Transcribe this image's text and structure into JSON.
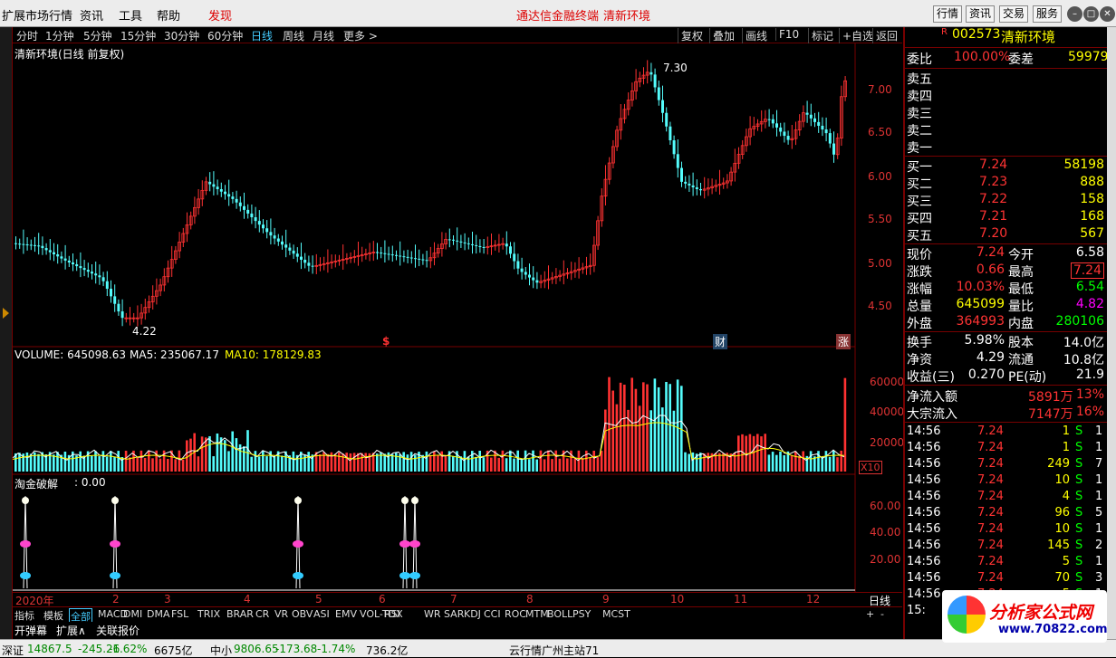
{
  "menu": {
    "items": [
      "扩展市场行情",
      "资讯",
      "工具",
      "帮助",
      "发现"
    ],
    "center": [
      "通达信金融终端",
      "清新环境"
    ],
    "right_buttons": [
      "行情",
      "资讯",
      "交易",
      "服务"
    ]
  },
  "periods": {
    "items": [
      "分时",
      "1分钟",
      "5分钟",
      "15分钟",
      "30分钟",
      "60分钟",
      "日线",
      "周线",
      "月线",
      "更多 >"
    ],
    "active": "日线",
    "tools": [
      "复权",
      "叠加",
      "画线",
      "F10",
      "标记",
      "+自选",
      "返回"
    ]
  },
  "main_chart": {
    "title": "清新环境(日线 前复权)",
    "high_label": "7.30",
    "low_label": "4.22",
    "price_ticks": [
      "7.00",
      "6.50",
      "6.00",
      "5.50",
      "5.00",
      "4.50"
    ],
    "markers": [
      "$",
      "财",
      "涨"
    ]
  },
  "volume_panel": {
    "label": "VOLUME: 645098.63",
    "ma5": "MA5: 235067.17",
    "ma10": "MA10: 178129.83",
    "ticks": [
      "60000",
      "40000",
      "20000"
    ],
    "unit": "X10"
  },
  "indicator_panel": {
    "label": "淘金破解",
    "value": ": 0.00",
    "ticks": [
      "60.00",
      "40.00",
      "20.00"
    ]
  },
  "date_axis": {
    "labels": [
      "2020年",
      "2",
      "3",
      "4",
      "5",
      "6",
      "7",
      "8",
      "9",
      "10",
      "11",
      "12"
    ],
    "period_label": "日线"
  },
  "indicator_tabs": {
    "items": [
      "指标",
      "模板",
      "全部",
      "MACD",
      "DMI",
      "DMA",
      "FSL",
      "TRIX",
      "BRAR",
      "CR",
      "VR",
      "OBV",
      "ASI",
      "EMV",
      "VOL-TDX",
      "RSI",
      "WR",
      "SAR",
      "KDJ",
      "CCI",
      "ROC",
      "MTM",
      "BOLL",
      "PSY",
      "MCST"
    ],
    "active": "全部"
  },
  "bottom_tabs": [
    "开弹幕",
    "扩展∧",
    "关联报价"
  ],
  "quote": {
    "code": "002573",
    "name": "清新环境",
    "flag": "R",
    "weibi": {
      "label": "委比",
      "value": "100.00%",
      "label2": "委差",
      "value2": "59979"
    },
    "sell": [
      {
        "label": "卖五"
      },
      {
        "label": "卖四"
      },
      {
        "label": "卖三"
      },
      {
        "label": "卖二"
      },
      {
        "label": "卖一"
      }
    ],
    "buy": [
      {
        "label": "买一",
        "price": "7.24",
        "vol": "58198"
      },
      {
        "label": "买二",
        "price": "7.23",
        "vol": "888"
      },
      {
        "label": "买三",
        "price": "7.22",
        "vol": "158"
      },
      {
        "label": "买四",
        "price": "7.21",
        "vol": "168"
      },
      {
        "label": "买五",
        "price": "7.20",
        "vol": "567"
      }
    ],
    "stats": [
      {
        "l1": "现价",
        "v1": "7.24",
        "l2": "今开",
        "v2": "6.58"
      },
      {
        "l1": "涨跌",
        "v1": "0.66",
        "l2": "最高",
        "v2": "7.24"
      },
      {
        "l1": "涨幅",
        "v1": "10.03%",
        "l2": "最低",
        "v2": "6.54"
      },
      {
        "l1": "总量",
        "v1": "645099",
        "l2": "量比",
        "v2": "4.82"
      },
      {
        "l1": "外盘",
        "v1": "364993",
        "l2": "内盘",
        "v2": "280106"
      },
      {
        "l1": "换手",
        "v1": "5.98%",
        "l2": "股本",
        "v2": "14.0亿"
      },
      {
        "l1": "净资",
        "v1": "4.29",
        "l2": "流通",
        "v2": "10.8亿"
      },
      {
        "l1": "收益(三)",
        "v1": "0.270",
        "l2": "PE(动)",
        "v2": "21.9"
      }
    ],
    "flow": [
      {
        "label": "净流入额",
        "value": "5891万",
        "pct": "13%"
      },
      {
        "label": "大宗流入",
        "value": "7147万",
        "pct": "16%"
      }
    ],
    "ticks": [
      {
        "t": "14:56",
        "p": "7.24",
        "v": "1",
        "s": "S",
        "n": "1"
      },
      {
        "t": "14:56",
        "p": "7.24",
        "v": "1",
        "s": "S",
        "n": "1"
      },
      {
        "t": "14:56",
        "p": "7.24",
        "v": "249",
        "s": "S",
        "n": "7"
      },
      {
        "t": "14:56",
        "p": "7.24",
        "v": "10",
        "s": "S",
        "n": "1"
      },
      {
        "t": "14:56",
        "p": "7.24",
        "v": "4",
        "s": "S",
        "n": "1"
      },
      {
        "t": "14:56",
        "p": "7.24",
        "v": "96",
        "s": "S",
        "n": "5"
      },
      {
        "t": "14:56",
        "p": "7.24",
        "v": "10",
        "s": "S",
        "n": "1"
      },
      {
        "t": "14:56",
        "p": "7.24",
        "v": "145",
        "s": "S",
        "n": "2"
      },
      {
        "t": "14:56",
        "p": "7.24",
        "v": "5",
        "s": "S",
        "n": "1"
      },
      {
        "t": "14:56",
        "p": "7.24",
        "v": "70",
        "s": "S",
        "n": "3"
      },
      {
        "t": "14:56",
        "p": "7.24",
        "v": "5",
        "s": "S",
        "n": "1"
      },
      {
        "t": "15:",
        "p": "",
        "v": "",
        "s": "",
        "n": ""
      }
    ]
  },
  "status": {
    "items": [
      "深证",
      "14867.5",
      "-245.26",
      "-1.62%",
      "6675亿",
      "中小",
      "9806.65",
      "-173.68",
      "-1.74%",
      "736.2亿",
      "云行情广州主站71"
    ]
  },
  "logo": {
    "title": "分析家公式网",
    "url": "www.70822.com"
  },
  "colors": {
    "up": "#ff3232",
    "down": "#54fcfc",
    "yellow": "#ffff00",
    "green": "#00ff00",
    "ma5": "#ffffff",
    "ma10": "#ffff00"
  }
}
